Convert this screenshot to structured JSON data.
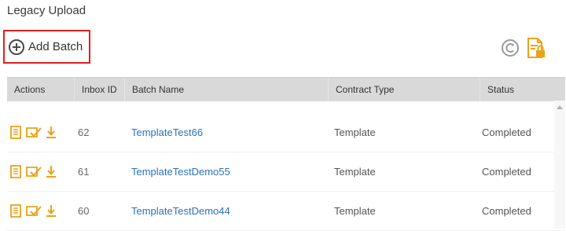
{
  "page": {
    "title": "Legacy Upload"
  },
  "toolbar": {
    "add_batch_label": "Add Batch"
  },
  "icons": {
    "add": "plus-circle-icon",
    "refresh": "refresh-icon",
    "report": "report-lock-icon",
    "view": "document-icon",
    "approve": "approve-icon",
    "download": "download-icon"
  },
  "colors": {
    "accent": "#e8a317",
    "link": "#2b73b7",
    "highlight_border": "#e02020",
    "header_bg": "#d9d9d9"
  },
  "table": {
    "headers": [
      "Actions",
      "Inbox ID",
      "Batch Name",
      "Contract Type",
      "Status"
    ],
    "rows": [
      {
        "inbox_id": "62",
        "batch_name": "TemplateTest66",
        "contract_type": "Template",
        "status": "Completed"
      },
      {
        "inbox_id": "61",
        "batch_name": "TemplateTestDemo55",
        "contract_type": "Template",
        "status": "Completed"
      },
      {
        "inbox_id": "60",
        "batch_name": "TemplateTestDemo44",
        "contract_type": "Template",
        "status": "Completed"
      }
    ]
  }
}
